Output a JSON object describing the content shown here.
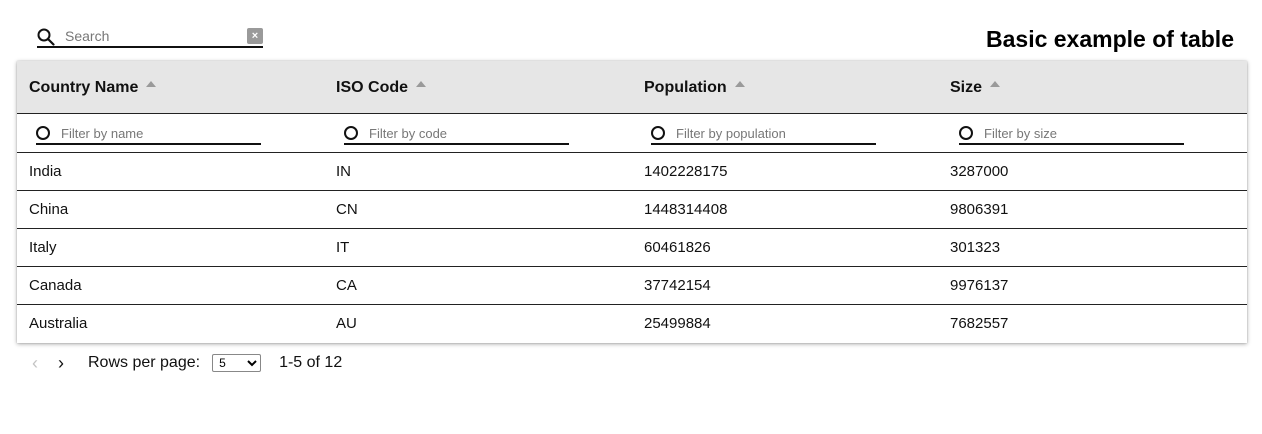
{
  "search": {
    "placeholder": "Search",
    "clear_glyph": "×",
    "icon": "search-icon"
  },
  "title": "Basic example of table",
  "table": {
    "columns": [
      {
        "label": "Country Name",
        "filter_placeholder": "Filter by name"
      },
      {
        "label": "ISO Code",
        "filter_placeholder": "Filter by code"
      },
      {
        "label": "Population",
        "filter_placeholder": "Filter by population"
      },
      {
        "label": "Size",
        "filter_placeholder": "Filter by size"
      }
    ],
    "rows": [
      [
        "India",
        "IN",
        "1402228175",
        "3287000"
      ],
      [
        "China",
        "CN",
        "1448314408",
        "9806391"
      ],
      [
        "Italy",
        "IT",
        "60461826",
        "301323"
      ],
      [
        "Canada",
        "CA",
        "37742154",
        "9976137"
      ],
      [
        "Australia",
        "AU",
        "25499884",
        "7682557"
      ]
    ]
  },
  "pagination": {
    "prev_glyph": "‹",
    "next_glyph": "›",
    "rows_per_page_label": "Rows per page:",
    "rows_per_page_value": "5",
    "range_text": "1-5 of 12"
  },
  "colors": {
    "header_bg": "#e6e6e6",
    "sort_arrow": "#9a9a9a",
    "border": "#222222"
  }
}
